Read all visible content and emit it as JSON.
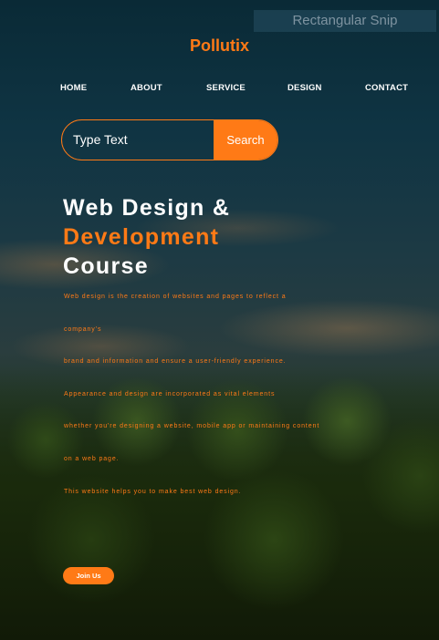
{
  "overlay": {
    "snip_label": "Rectangular Snip"
  },
  "brand": {
    "name": "Pollutix",
    "accent_color": "#ff7a16"
  },
  "nav": {
    "items": [
      "HOME",
      "ABOUT",
      "SERVICE",
      "DESIGN",
      "CONTACT"
    ]
  },
  "search": {
    "input_text": "Type Text",
    "button_label": "Search"
  },
  "hero": {
    "line1": "Web Design &",
    "line2": "Development",
    "line3": "Course"
  },
  "description": {
    "lines": [
      "Web design is the creation of websites and pages to reflect a",
      "company's",
      "brand and information and ensure a user-friendly experience.",
      "Appearance and design are incorporated as vital elements",
      "whether you're designing a website, mobile app or maintaining content",
      "on a web page.",
      "This website helps you to make best web design."
    ]
  },
  "cta": {
    "join_label": "Join Us"
  }
}
